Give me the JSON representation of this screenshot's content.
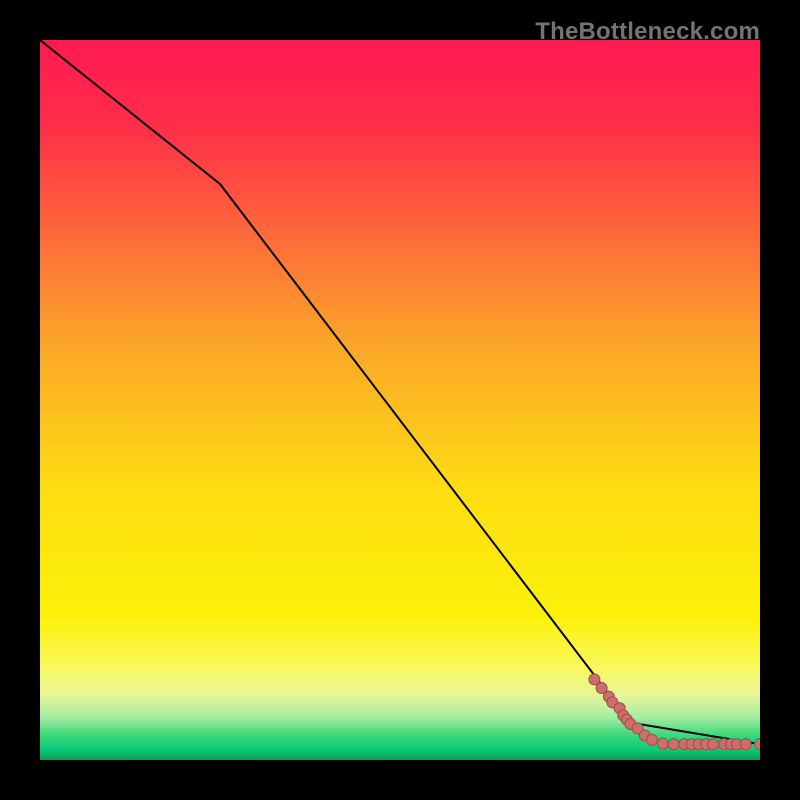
{
  "watermark": "TheBottleneck.com",
  "chart_data": {
    "type": "line",
    "title": "",
    "xlabel": "",
    "ylabel": "",
    "xlim": [
      0,
      100
    ],
    "ylim": [
      0,
      100
    ],
    "grid": false,
    "legend": false,
    "background_gradient_stops": [
      {
        "offset": 0.0,
        "color": "#ff1a52"
      },
      {
        "offset": 0.12,
        "color": "#ff2e49"
      },
      {
        "offset": 0.42,
        "color": "#fba52a"
      },
      {
        "offset": 0.62,
        "color": "#fddc12"
      },
      {
        "offset": 0.8,
        "color": "#fcf108"
      },
      {
        "offset": 0.87,
        "color": "#faf85e"
      },
      {
        "offset": 0.91,
        "color": "#e7f69a"
      },
      {
        "offset": 0.94,
        "color": "#a5eda2"
      },
      {
        "offset": 0.965,
        "color": "#3ed97b"
      },
      {
        "offset": 0.985,
        "color": "#0ccb7a"
      },
      {
        "offset": 1.0,
        "color": "#0b9b58"
      }
    ],
    "series": [
      {
        "name": "black-curve",
        "x": [
          0,
          25,
          82,
          100
        ],
        "y": [
          100,
          80,
          5.2,
          2.2
        ]
      },
      {
        "name": "salmon-points",
        "points": [
          {
            "x": 77.0,
            "y": 11.2
          },
          {
            "x": 78.0,
            "y": 10.0
          },
          {
            "x": 79.0,
            "y": 8.8
          },
          {
            "x": 79.5,
            "y": 8.0
          },
          {
            "x": 80.5,
            "y": 7.2
          },
          {
            "x": 81.0,
            "y": 6.2
          },
          {
            "x": 81.5,
            "y": 5.6
          },
          {
            "x": 82.0,
            "y": 5.0
          },
          {
            "x": 83.0,
            "y": 4.4
          },
          {
            "x": 84.0,
            "y": 3.4
          },
          {
            "x": 85.0,
            "y": 2.8
          },
          {
            "x": 86.5,
            "y": 2.3
          },
          {
            "x": 88.0,
            "y": 2.2
          },
          {
            "x": 89.5,
            "y": 2.2
          },
          {
            "x": 90.5,
            "y": 2.2
          },
          {
            "x": 91.5,
            "y": 2.2
          },
          {
            "x": 92.5,
            "y": 2.2
          },
          {
            "x": 93.5,
            "y": 2.2
          },
          {
            "x": 95.0,
            "y": 2.2
          },
          {
            "x": 96.0,
            "y": 2.2
          },
          {
            "x": 96.8,
            "y": 2.2
          },
          {
            "x": 98.0,
            "y": 2.2
          },
          {
            "x": 100.0,
            "y": 2.2
          }
        ]
      }
    ]
  }
}
